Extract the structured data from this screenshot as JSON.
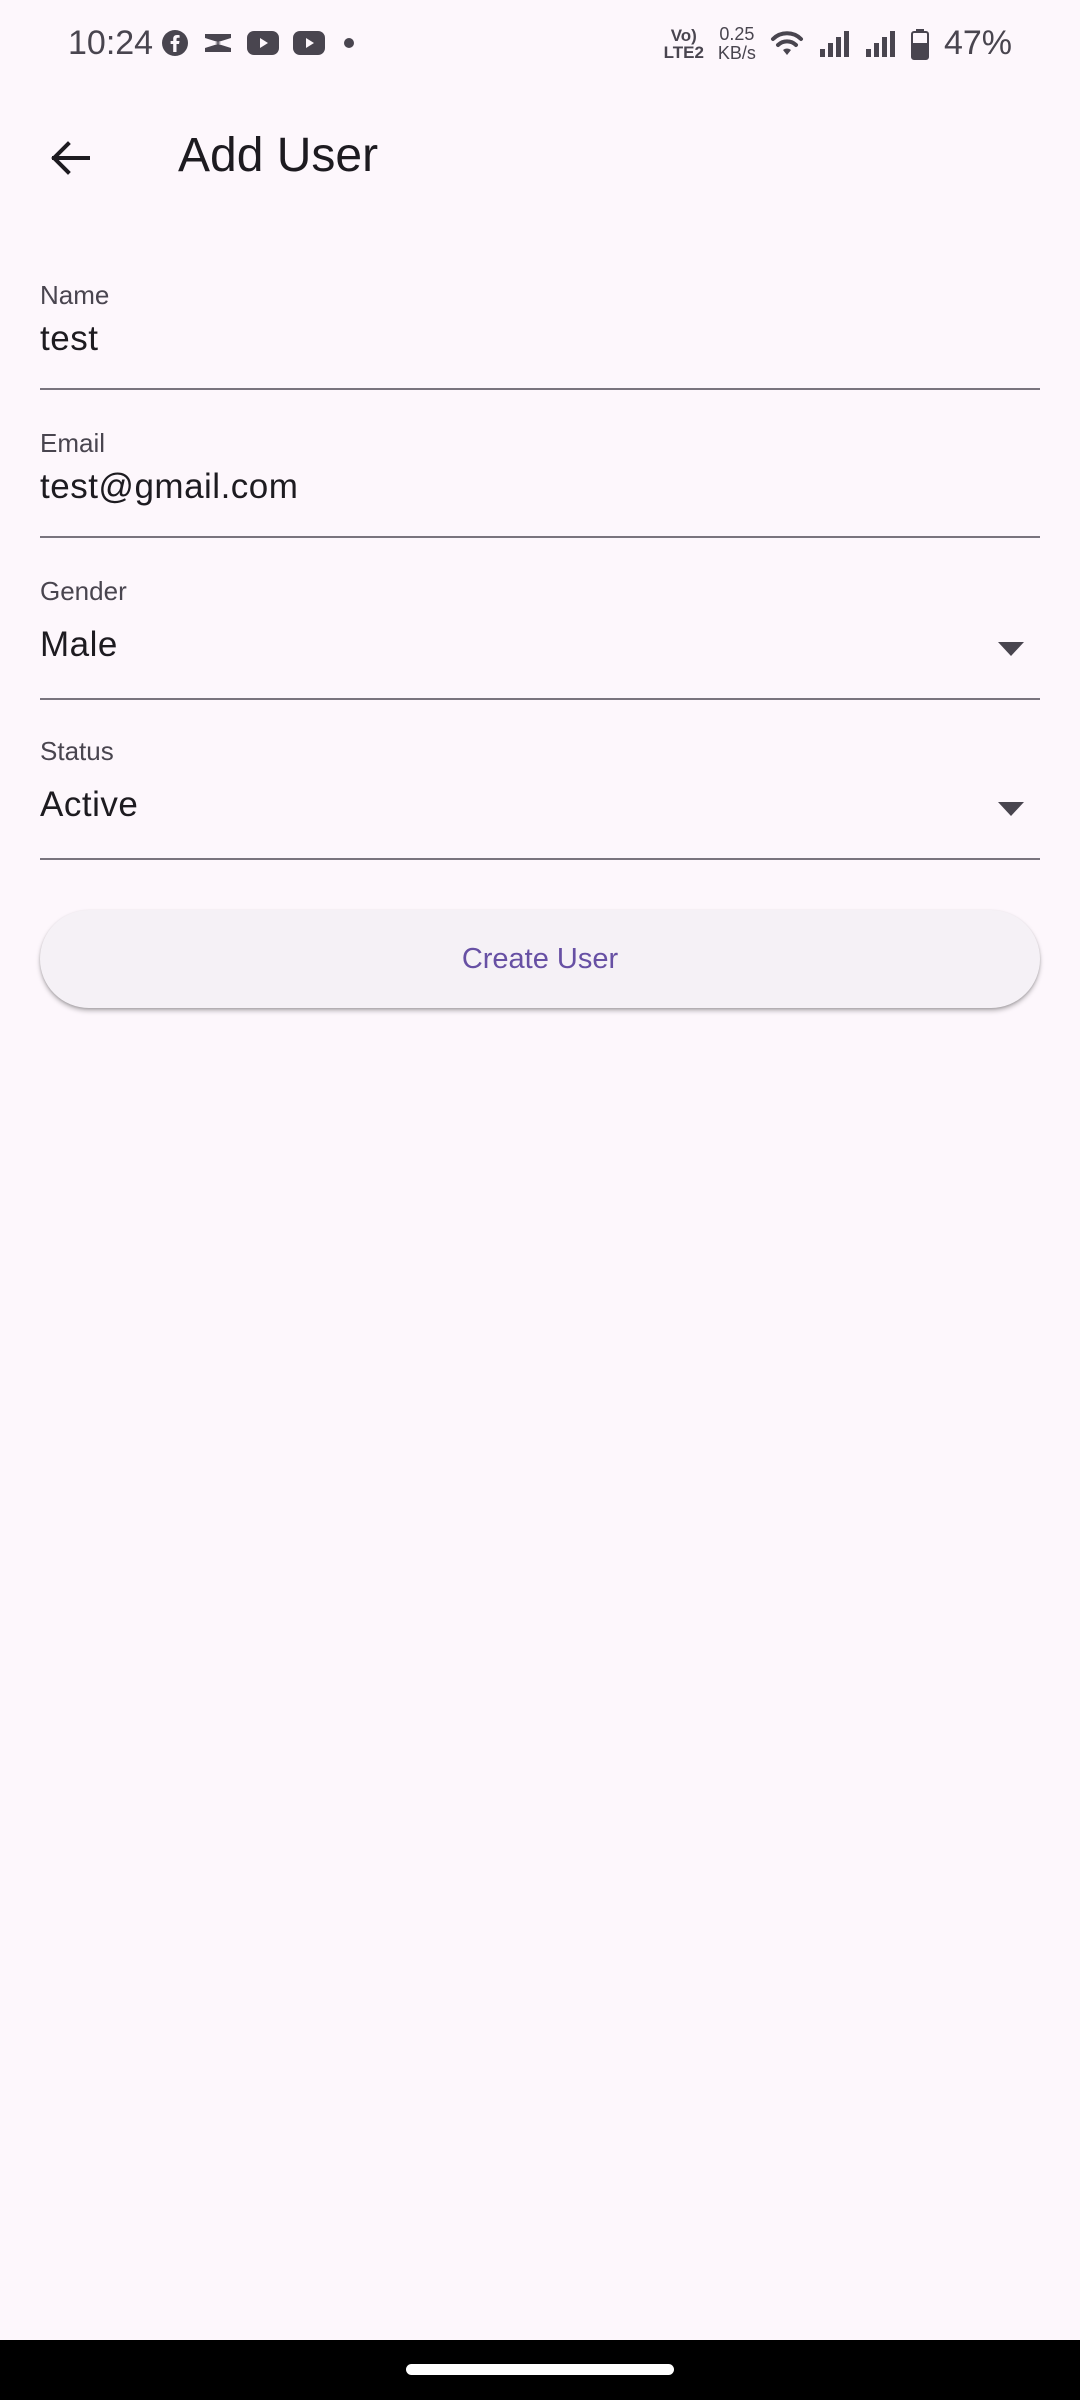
{
  "status_bar": {
    "time": "10:24",
    "notification_icons": [
      "facebook-icon",
      "capcut-icon",
      "youtube-icon",
      "youtube-icon",
      "dot-icon"
    ],
    "network_label_top": "Vo)",
    "network_label_bottom": "LTE2",
    "speed_value": "0.25",
    "speed_unit": "KB/s",
    "battery_percent": "47%"
  },
  "app_bar": {
    "title": "Add User",
    "back_icon": "arrow-back-icon"
  },
  "form": {
    "name": {
      "label": "Name",
      "value": "test"
    },
    "email": {
      "label": "Email",
      "value": "test@gmail.com"
    },
    "gender": {
      "label": "Gender",
      "value": "Male"
    },
    "status": {
      "label": "Status",
      "value": "Active"
    }
  },
  "actions": {
    "create_label": "Create User"
  },
  "colors": {
    "background": "#FDF7FC",
    "primary": "#6750A4",
    "on_surface": "#1D1B20",
    "on_surface_variant": "#49454F",
    "outline": "#79747E",
    "button_surface": "#F5F1F6"
  }
}
